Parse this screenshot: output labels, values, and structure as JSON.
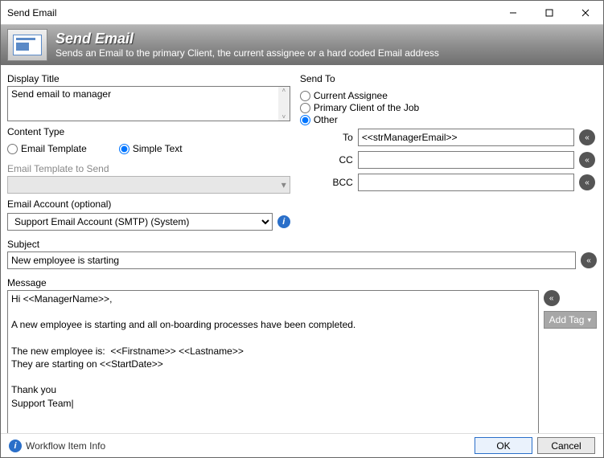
{
  "window": {
    "title": "Send Email"
  },
  "banner": {
    "title": "Send Email",
    "subtitle": "Sends an Email to the primary Client, the current assignee or a hard coded Email address"
  },
  "labels": {
    "display_title": "Display Title",
    "content_type": "Content Type",
    "email_template_opt": "Email Template",
    "simple_text_opt": "Simple Text",
    "template_to_send": "Email Template to Send",
    "email_account": "Email Account (optional)",
    "send_to": "Send To",
    "opt_assignee": "Current Assignee",
    "opt_primary": "Primary Client of the Job",
    "opt_other": "Other",
    "to": "To",
    "cc": "CC",
    "bcc": "BCC",
    "subject": "Subject",
    "message": "Message",
    "add_tag": "Add Tag",
    "workflow_info": "Workflow Item Info",
    "ok": "OK",
    "cancel": "Cancel"
  },
  "values": {
    "display_title": "Send email to manager",
    "content_type": "simple",
    "email_account": "Support Email Account (SMTP)   (System)",
    "send_to": "other",
    "to": "<<strManagerEmail>>",
    "cc": "",
    "bcc": "",
    "subject": "New employee is starting",
    "message": "Hi <<ManagerName>>,\n\nA new employee is starting and all on-boarding processes have been completed.\n\nThe new employee is:  <<Firstname>> <<Lastname>>\nThey are starting on <<StartDate>>\n\nThank you\nSupport Team|"
  }
}
